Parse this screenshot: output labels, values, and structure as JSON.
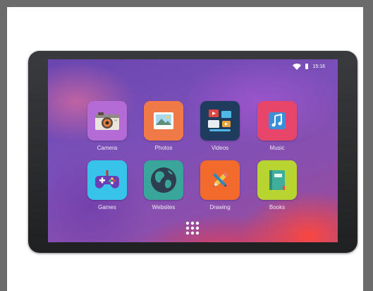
{
  "status_bar": {
    "time": "15:16",
    "icons": [
      "wifi-icon",
      "battery-icon"
    ]
  },
  "apps": [
    {
      "label": "Camera",
      "color": "#b46bd6",
      "icon": "camera-icon"
    },
    {
      "label": "Photos",
      "color": "#f07a47",
      "icon": "photo-icon"
    },
    {
      "label": "Videos",
      "color": "#1f3b5e",
      "icon": "video-icon"
    },
    {
      "label": "Music",
      "color": "#e8456a",
      "icon": "music-note-icon"
    },
    {
      "label": "Games",
      "color": "#38c3ea",
      "icon": "gamepad-icon"
    },
    {
      "label": "Websites",
      "color": "#3aa59a",
      "icon": "globe-icon"
    },
    {
      "label": "Drawing",
      "color": "#f26a2c",
      "icon": "pencil-icon"
    },
    {
      "label": "Books",
      "color": "#b8d431",
      "icon": "book-icon"
    }
  ],
  "dock": {
    "icon": "app-drawer-icon"
  }
}
